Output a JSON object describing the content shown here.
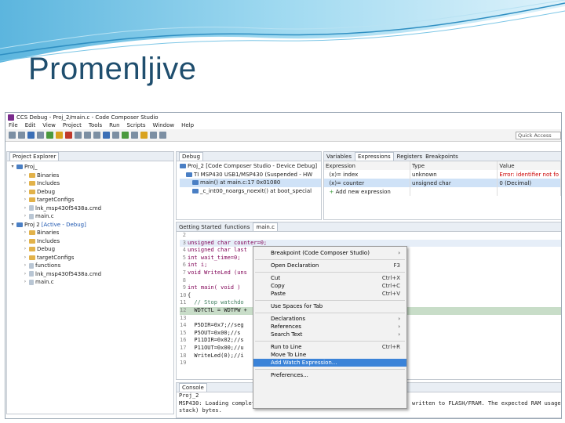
{
  "slide": {
    "title": "Promenljive"
  },
  "window": {
    "title": "CCS Debug - Proj_2/main.c - Code Composer Studio",
    "menu": [
      "File",
      "Edit",
      "View",
      "Project",
      "Tools",
      "Run",
      "Scripts",
      "Window",
      "Help"
    ],
    "quick_access_placeholder": "Quick Access"
  },
  "explorer": {
    "tab": "Project Explorer",
    "items": [
      {
        "label": "Proj_",
        "suffix": "",
        "level": 0,
        "arrow": "▾",
        "kind": "project"
      },
      {
        "label": "Binaries",
        "suffix": "",
        "level": 1,
        "arrow": "›",
        "kind": "folder"
      },
      {
        "label": "Includes",
        "suffix": "",
        "level": 1,
        "arrow": "›",
        "kind": "folder"
      },
      {
        "label": "Debug",
        "suffix": "",
        "level": 1,
        "arrow": "›",
        "kind": "folder"
      },
      {
        "label": "targetConfigs",
        "suffix": "",
        "level": 1,
        "arrow": "›",
        "kind": "folder"
      },
      {
        "label": "lnk_msp430f5438a.cmd",
        "suffix": "",
        "level": 1,
        "arrow": "›",
        "kind": "file"
      },
      {
        "label": "main.c",
        "suffix": "",
        "level": 1,
        "arrow": "›",
        "kind": "file"
      },
      {
        "label": "Proj 2",
        "suffix": "[Active - Debug]",
        "level": 0,
        "arrow": "▾",
        "kind": "project"
      },
      {
        "label": "Binaries",
        "suffix": "",
        "level": 1,
        "arrow": "›",
        "kind": "folder"
      },
      {
        "label": "Includes",
        "suffix": "",
        "level": 1,
        "arrow": "›",
        "kind": "folder"
      },
      {
        "label": "Debug",
        "suffix": "",
        "level": 1,
        "arrow": "›",
        "kind": "folder"
      },
      {
        "label": "targetConfigs",
        "suffix": "",
        "level": 1,
        "arrow": "›",
        "kind": "folder"
      },
      {
        "label": "functions",
        "suffix": "",
        "level": 1,
        "arrow": "›",
        "kind": "file"
      },
      {
        "label": "lnk_msp430f5438a.cmd",
        "suffix": "",
        "level": 1,
        "arrow": "›",
        "kind": "file"
      },
      {
        "label": "main.c",
        "suffix": "",
        "level": 1,
        "arrow": "›",
        "kind": "file"
      }
    ]
  },
  "debug": {
    "tab": "Debug",
    "lines": [
      "Proj_2 [Code Composer Studio - Device Debug]",
      "TI MSP430 USB1/MSP430 (Suspended - HW",
      "main() at main.c:17 0x01080",
      "_c_int00_noargs_noexit() at boot_special"
    ]
  },
  "expressions": {
    "tabs": [
      "Variables",
      "Expressions",
      "Registers",
      "Breakpoints"
    ],
    "columns": [
      "Expression",
      "Type",
      "Value"
    ],
    "rows": [
      {
        "expr": "index",
        "type": "unknown",
        "value": "Error: identifier not fo"
      },
      {
        "expr": "counter",
        "type": "unsigned char",
        "value": "0 (Decimal)"
      },
      {
        "expr": "Add new expression",
        "type": "",
        "value": ""
      }
    ]
  },
  "editor": {
    "tabs": [
      "Getting Started",
      "functions",
      "main.c"
    ],
    "lines": [
      {
        "n": "2",
        "text": ""
      },
      {
        "n": "3",
        "text": "unsigned char counter=0;"
      },
      {
        "n": "4",
        "text": "unsigned char last"
      },
      {
        "n": "5",
        "text": "int wait_time=0;"
      },
      {
        "n": "6",
        "text": "int i;"
      },
      {
        "n": "7",
        "text": "void WriteLed (uns"
      },
      {
        "n": "8",
        "text": ""
      },
      {
        "n": "9",
        "text": "int main( void )"
      },
      {
        "n": "10",
        "text": "{"
      },
      {
        "n": "11",
        "text": "  // Stop watchdo"
      },
      {
        "n": "12",
        "text": "  WDTCTL = WDTPW +"
      },
      {
        "n": "13",
        "text": ""
      },
      {
        "n": "14",
        "text": "  P5DIR=0x7;//seg"
      },
      {
        "n": "15",
        "text": "  P5OUT=0x00;//s"
      },
      {
        "n": "16",
        "text": "  P11DIR=0x02;//s"
      },
      {
        "n": "17",
        "text": "  P11OUT=0x00;//u"
      },
      {
        "n": "18",
        "text": "  WriteLed(0);//i"
      },
      {
        "n": "19",
        "text": ""
      }
    ]
  },
  "console": {
    "tab": "Console",
    "lines": [
      "Proj_2",
      "MSP430: Loading complete",
      "stack) bytes."
    ],
    "tail": "written to FLASH/FRAM. The expected RAM usage"
  },
  "context_menu": {
    "items": [
      {
        "label": "Breakpoint (Code Composer Studio)",
        "key": "›",
        "sep_after": true
      },
      {
        "label": "Open Declaration",
        "key": "F3",
        "sep_after": true
      },
      {
        "label": "Cut",
        "key": "Ctrl+X"
      },
      {
        "label": "Copy",
        "key": "Ctrl+C"
      },
      {
        "label": "Paste",
        "key": "Ctrl+V",
        "sep_after": true
      },
      {
        "label": "Use Spaces for Tab",
        "key": "",
        "sep_after": true
      },
      {
        "label": "Declarations",
        "key": "›"
      },
      {
        "label": "References",
        "key": "›"
      },
      {
        "label": "Search Text",
        "key": "›",
        "sep_after": true
      },
      {
        "label": "Run to Line",
        "key": "Ctrl+R"
      },
      {
        "label": "Move To Line",
        "key": ""
      },
      {
        "label": "Add Watch Expression...",
        "key": "",
        "highlight": true,
        "sep_after": true
      },
      {
        "label": "Preferences...",
        "key": ""
      }
    ]
  },
  "colors": {
    "title": "#1f4e6e",
    "selection": "#3b83d8",
    "error": "#cc0000"
  }
}
